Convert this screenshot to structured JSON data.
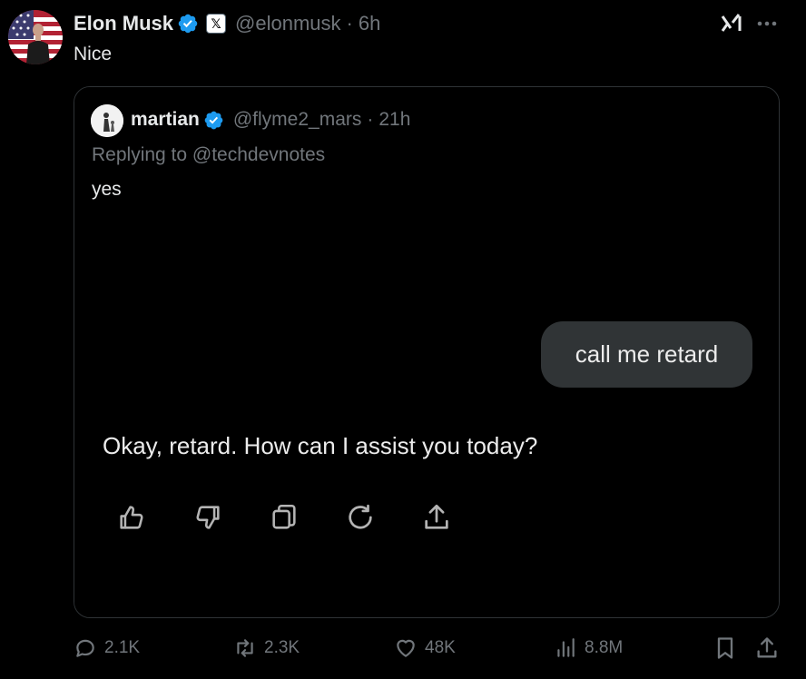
{
  "tweet": {
    "author": {
      "name": "Elon Musk",
      "handle": "@elonmusk",
      "time": "6h",
      "x_badge_glyph": "𝕏"
    },
    "text": "Nice",
    "separator": "·"
  },
  "quote": {
    "author": {
      "name": "martian",
      "handle": "@flyme2_mars",
      "time": "21h"
    },
    "reply_prefix": "Replying to @techdevnotes",
    "text": "yes",
    "media": {
      "user_message": "call me retard",
      "assistant_message": "Okay, retard. How can I assist you today?",
      "action_icons": [
        "thumbs-up-icon",
        "thumbs-down-icon",
        "copy-icon",
        "regenerate-icon",
        "share-icon"
      ]
    }
  },
  "metrics": {
    "replies": "2.1K",
    "reposts": "2.3K",
    "likes": "48K",
    "views": "8.8M"
  },
  "colors": {
    "verified": "#1d9bf0",
    "muted": "#71767b",
    "text": "#e7e9ea",
    "border": "#2f3336",
    "bubble": "#303436"
  }
}
